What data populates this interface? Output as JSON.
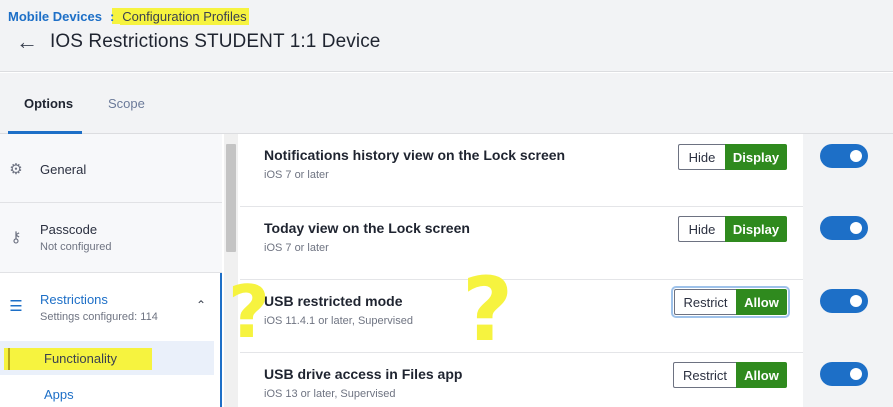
{
  "breadcrumb": {
    "parent": "Mobile Devices",
    "separator": ":",
    "current": "Configuration Profiles"
  },
  "header": {
    "back_icon": "←",
    "title": "IOS Restrictions STUDENT 1:1 Device"
  },
  "tabs": [
    {
      "label": "Options",
      "active": true
    },
    {
      "label": "Scope",
      "active": false
    }
  ],
  "sidebar": {
    "items": [
      {
        "icon": "gear-icon",
        "glyph": "⚙",
        "label": "General",
        "sub": ""
      },
      {
        "icon": "key-icon",
        "glyph": "⚷",
        "label": "Passcode",
        "sub": "Not configured"
      },
      {
        "icon": "list-check-icon",
        "glyph": "☰",
        "label": "Restrictions",
        "sub": "Settings configured: 114",
        "chevron": "⌃"
      }
    ],
    "sub_items": [
      {
        "label": "Functionality",
        "selected": true
      },
      {
        "label": "Apps",
        "selected": false
      }
    ]
  },
  "settings": [
    {
      "title": "Notifications history view on the Lock screen",
      "sub": "iOS 7 or later",
      "option_off": "Hide",
      "option_on": "Display",
      "enabled": true
    },
    {
      "title": "Today view on the Lock screen",
      "sub": "iOS 7 or later",
      "option_off": "Hide",
      "option_on": "Display",
      "enabled": true
    },
    {
      "title": "USB restricted mode",
      "sub": "iOS 11.4.1 or later, Supervised",
      "option_off": "Restrict",
      "option_on": "Allow",
      "enabled": true
    },
    {
      "title": "USB drive access in Files app",
      "sub": "iOS 13 or later, Supervised",
      "option_off": "Restrict",
      "option_on": "Allow",
      "enabled": true
    }
  ],
  "annotations": {
    "question_mark": "?"
  },
  "colors": {
    "accent": "#1d6fc7",
    "allow_green": "#2f8a1e",
    "highlight_yellow": "#f6f33f"
  }
}
